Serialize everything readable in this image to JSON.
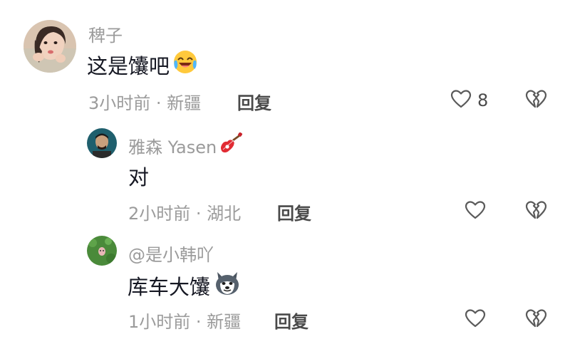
{
  "comments": [
    {
      "username": "稗子",
      "text": "这是馕吧",
      "emoji": "laughing-crying-face-icon",
      "time": "3小时前",
      "location": "新疆",
      "reply_label": "回复",
      "like_count": "8"
    },
    {
      "username": "雅森 Yasen",
      "name_emoji": "guitar-icon",
      "text": "对",
      "time": "2小时前",
      "location": "湖北",
      "reply_label": "回复",
      "like_count": ""
    },
    {
      "username": "@是小韩吖",
      "text": "库车大馕",
      "emoji": "husky-dog-icon",
      "time": "1小时前",
      "location": "新疆",
      "reply_label": "回复",
      "like_count": ""
    }
  ],
  "meta_separator": " · ",
  "colors": {
    "primary_text": "#161823",
    "secondary_text": "#9b9b9b",
    "icon": "#5a5a5a"
  }
}
